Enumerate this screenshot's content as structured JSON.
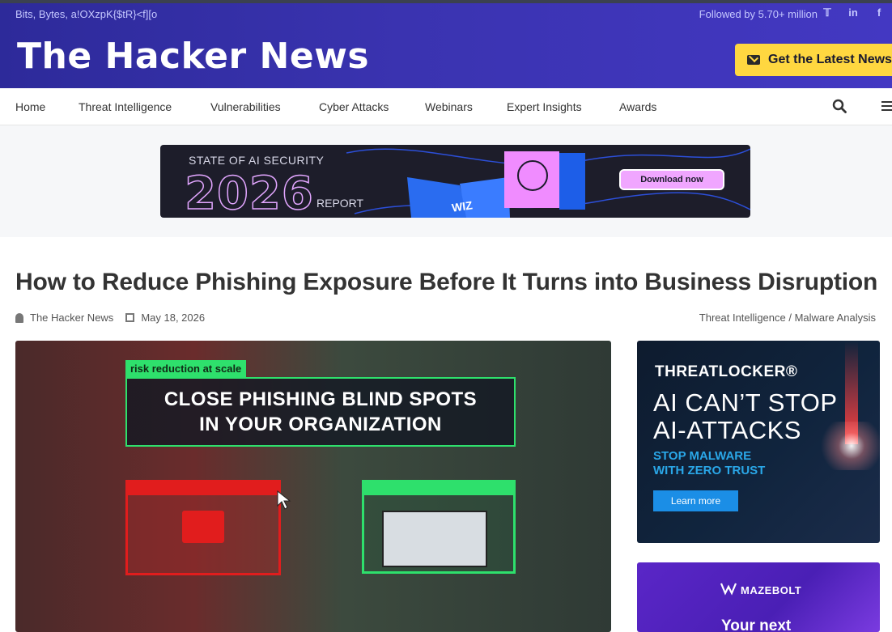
{
  "header": {
    "tagline": "Bits, Bytes, a!OXzpK{$tR}<f][o",
    "followed": "Followed by 5.70+ million",
    "social": [
      "twitter-icon",
      "linkedin-icon",
      "facebook-icon"
    ],
    "social_glyphs": [
      "𝕋",
      "in",
      "f"
    ],
    "logo": "The Hacker News",
    "cta_label": "Get the Latest News",
    "colors": {
      "header": "#3a33b0",
      "cta": "#ffd740"
    }
  },
  "nav": {
    "items": [
      "Home",
      "Threat Intelligence",
      "Vulnerabilities",
      "Cyber Attacks",
      "Webinars",
      "Expert Insights",
      "Awards"
    ]
  },
  "banner": {
    "line1": "STATE OF AI SECURITY",
    "year": "2026",
    "line2": "REPORT",
    "brand": "WIZ",
    "button": "Download now"
  },
  "article": {
    "title": "How to Reduce Phishing Exposure Before It Turns into Business Disruption",
    "author": "The Hacker News",
    "date": "May 18, 2026",
    "categories": "Threat Intelligence / Malware Analysis",
    "hero_tag": "risk reduction at scale",
    "hero_line1": "CLOSE PHISHING BLIND SPOTS",
    "hero_line2": "IN YOUR ORGANIZATION"
  },
  "ad1": {
    "brand": "THREATLOCKER®",
    "headline1": "AI CAN’T STOP",
    "headline2": "AI-ATTACKS",
    "sub1": "STOP MALWARE",
    "sub2": "WITH ZERO TRUST",
    "button": "Learn more"
  },
  "ad2": {
    "brand": "MAZEBOLT",
    "text": "Your next"
  }
}
